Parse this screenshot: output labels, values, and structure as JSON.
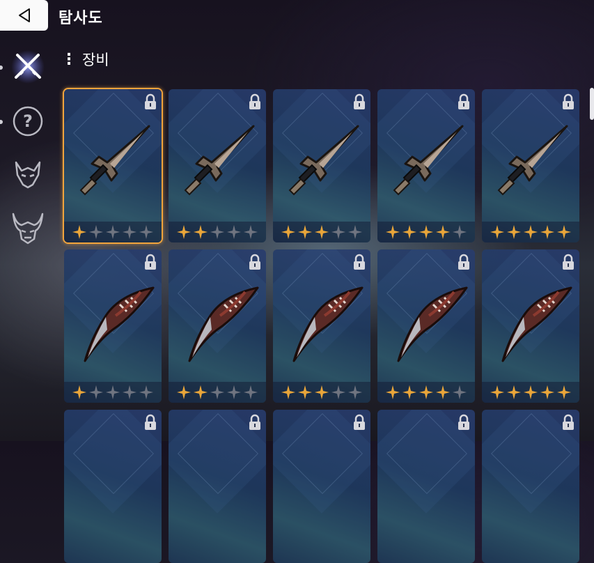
{
  "header": {
    "title": "탐사도",
    "back_icon": "back-triangle-icon"
  },
  "section": {
    "label": "장비"
  },
  "sidebar": {
    "items": [
      {
        "name": "equipment",
        "icon": "crossed-swords-icon",
        "active": true
      },
      {
        "name": "unknown",
        "icon": "question-mark-icon",
        "active": false
      },
      {
        "name": "monster",
        "icon": "demon-mask-icon",
        "active": false
      },
      {
        "name": "boss",
        "icon": "horned-demon-mask-icon",
        "active": false
      }
    ]
  },
  "items": [
    {
      "weapon": "dagger",
      "stars": 1,
      "locked": true,
      "selected": true
    },
    {
      "weapon": "dagger",
      "stars": 2,
      "locked": true
    },
    {
      "weapon": "dagger",
      "stars": 3,
      "locked": true
    },
    {
      "weapon": "dagger",
      "stars": 4,
      "locked": true
    },
    {
      "weapon": "dagger",
      "stars": 5,
      "locked": true
    },
    {
      "weapon": "claw",
      "stars": 1,
      "locked": true
    },
    {
      "weapon": "claw",
      "stars": 2,
      "locked": true
    },
    {
      "weapon": "claw",
      "stars": 3,
      "locked": true
    },
    {
      "weapon": "claw",
      "stars": 4,
      "locked": true
    },
    {
      "weapon": "claw",
      "stars": 5,
      "locked": true
    },
    {
      "weapon": "hidden",
      "stars": 0,
      "locked": true
    },
    {
      "weapon": "hidden",
      "stars": 0,
      "locked": true
    },
    {
      "weapon": "hidden",
      "stars": 0,
      "locked": true
    },
    {
      "weapon": "hidden",
      "stars": 0,
      "locked": true
    },
    {
      "weapon": "hidden",
      "stars": 0,
      "locked": true
    }
  ],
  "colors": {
    "star_on": "#e8a53a",
    "star_off": "#6f7480",
    "selected_border": "#f1a43c"
  }
}
